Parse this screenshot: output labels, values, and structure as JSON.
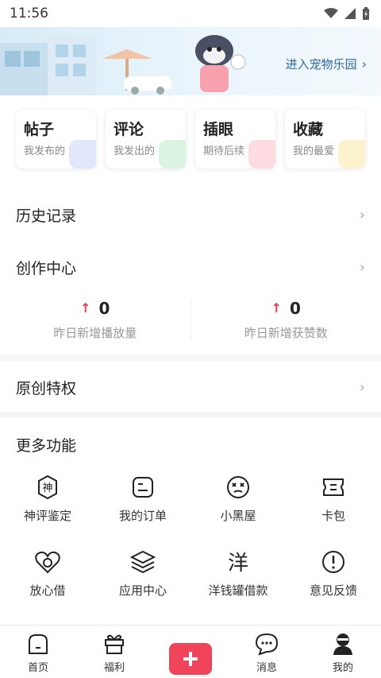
{
  "status": {
    "time": "11:56"
  },
  "banner": {
    "link_label": "进入宠物乐园"
  },
  "quick_cards": [
    {
      "title": "帖子",
      "sub": "我发布的",
      "deco_color": "#c9d6f7"
    },
    {
      "title": "评论",
      "sub": "我发出的",
      "deco_color": "#b9ebc9"
    },
    {
      "title": "插眼",
      "sub": "期待后续",
      "deco_color": "#f9c0c8"
    },
    {
      "title": "收藏",
      "sub": "我的最爱",
      "deco_color": "#fbe7a6"
    }
  ],
  "history": {
    "label": "历史记录"
  },
  "creation": {
    "label": "创作中心",
    "stats": [
      {
        "value": "0",
        "label": "昨日新增播放量"
      },
      {
        "value": "0",
        "label": "昨日新增获赞数"
      }
    ]
  },
  "original": {
    "label": "原创特权"
  },
  "more": {
    "title": "更多功能",
    "items": [
      {
        "label": "神评鉴定",
        "icon": "shen-badge-icon"
      },
      {
        "label": "我的订单",
        "icon": "order-icon"
      },
      {
        "label": "小黑屋",
        "icon": "dizzy-face-icon"
      },
      {
        "label": "卡包",
        "icon": "ticket-icon"
      },
      {
        "label": "放心借",
        "icon": "heart-coin-icon"
      },
      {
        "label": "应用中心",
        "icon": "layers-icon"
      },
      {
        "label": "洋钱罐借款",
        "icon": "yang-icon"
      },
      {
        "label": "意见反馈",
        "icon": "exclamation-circle-icon"
      }
    ]
  },
  "tabbar": {
    "home": "首页",
    "welfare": "福利",
    "messages": "消息",
    "mine": "我的"
  },
  "colors": {
    "accent": "#f0445a",
    "link": "#2f6aa8"
  }
}
